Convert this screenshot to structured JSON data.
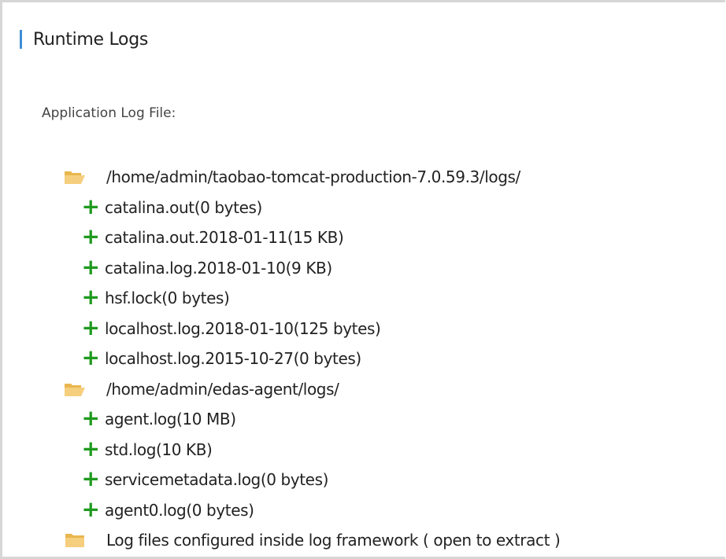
{
  "panel": {
    "title": "Runtime Logs",
    "section_label": "Application Log File:"
  },
  "tree": [
    {
      "kind": "folder-open",
      "icon": "folder-open-icon",
      "label": "/home/admin/taobao-tomcat-production-7.0.59.3/logs/"
    },
    {
      "kind": "file",
      "icon": "plus-icon",
      "label": "catalina.out(0 bytes)"
    },
    {
      "kind": "file",
      "icon": "plus-icon",
      "label": "catalina.out.2018-01-11(15 KB)"
    },
    {
      "kind": "file",
      "icon": "plus-icon",
      "label": "catalina.log.2018-01-10(9 KB)"
    },
    {
      "kind": "file",
      "icon": "plus-icon",
      "label": "hsf.lock(0 bytes)"
    },
    {
      "kind": "file",
      "icon": "plus-icon",
      "label": "localhost.log.2018-01-10(125 bytes)"
    },
    {
      "kind": "file",
      "icon": "plus-icon",
      "label": "localhost.log.2015-10-27(0 bytes)"
    },
    {
      "kind": "folder-open",
      "icon": "folder-open-icon",
      "label": "/home/admin/edas-agent/logs/"
    },
    {
      "kind": "file",
      "icon": "plus-icon",
      "label": "agent.log(10 MB)"
    },
    {
      "kind": "file",
      "icon": "plus-icon",
      "label": "std.log(10 KB)"
    },
    {
      "kind": "file",
      "icon": "plus-icon",
      "label": "servicemetadata.log(0 bytes)"
    },
    {
      "kind": "file",
      "icon": "plus-icon",
      "label": "agent0.log(0 bytes)"
    },
    {
      "kind": "folder-closed",
      "icon": "folder-closed-icon",
      "label": "Log files configured inside log framework ( open to extract )"
    }
  ],
  "colors": {
    "accent": "#3e8dd6",
    "plus": "#1f9a1f",
    "folder": "#f2c56d"
  }
}
